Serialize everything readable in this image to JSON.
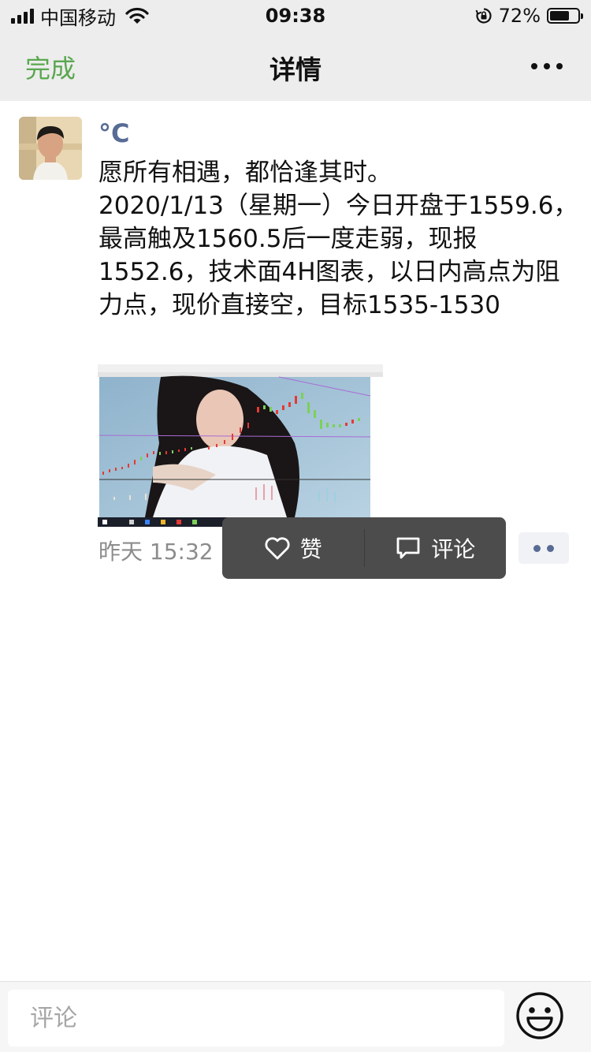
{
  "status_bar": {
    "carrier": "中国移动",
    "time": "09:38",
    "battery": "72%",
    "battery_level": 0.72
  },
  "nav": {
    "done": "完成",
    "title": "详情"
  },
  "post": {
    "author": "°C",
    "text": "愿所有相遇，都恰逢其时。\n2020/1/13（星期一）今日开盘于1559.6，最高触及1560.5后一度走弱，现报1552.6，技术面4H图表，以日内高点为阻力点，现价直接空，目标1535-1530",
    "timestamp": "昨天 15:32"
  },
  "actions": {
    "like": "赞",
    "comment": "评论"
  },
  "comment_bar": {
    "placeholder": "评论"
  },
  "colors": {
    "accent_green": "#5aa74f",
    "name_blue": "#576b95",
    "popup_bg": "#4c4c4c",
    "nav_bg": "#ededed"
  },
  "icons": [
    "signal-icon",
    "wifi-icon",
    "rotation-lock-icon",
    "battery-icon",
    "more-icon",
    "heart-icon",
    "comment-icon",
    "emoji-icon"
  ]
}
